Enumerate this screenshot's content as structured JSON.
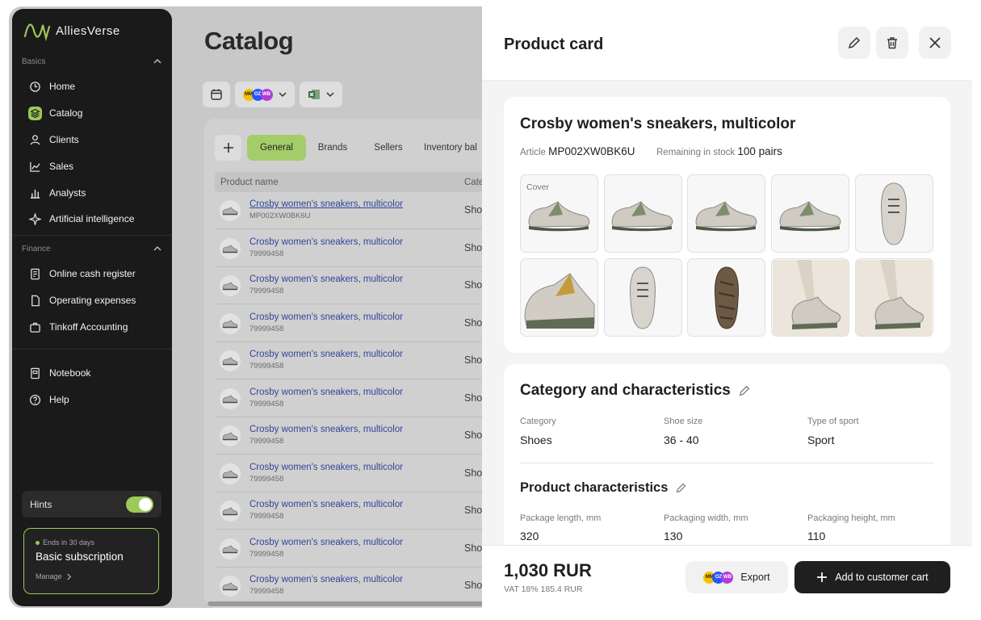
{
  "sidebar": {
    "logo_text": "AlliesVerse",
    "sections": [
      {
        "title": "Basics",
        "items": [
          "Home",
          "Catalog",
          "Clients",
          "Sales",
          "Analysts",
          "Artificial intelligence"
        ]
      },
      {
        "title": "Finance",
        "items": [
          "Online cash register",
          "Operating expenses",
          "Tinkoff Accounting"
        ]
      }
    ],
    "extra_items": [
      "Notebook",
      "Help"
    ],
    "hints_label": "Hints",
    "hints_on": true,
    "subscription": {
      "ends": "Ends in 30 days",
      "title": "Basic subscription",
      "manage": "Manage"
    },
    "accent_color": "#9bc95a"
  },
  "catalog": {
    "title": "Catalog",
    "marketplaces": [
      "MM",
      "OZ",
      "WB"
    ],
    "tabs": [
      "General",
      "Brands",
      "Sellers",
      "Inventory bal"
    ],
    "active_tab": "General",
    "columns": [
      "Product name",
      "Cate"
    ],
    "rows": [
      {
        "name": "Crosby women's sneakers, multicolor",
        "code": "MP002XW0BK6U",
        "category": "Sho"
      },
      {
        "name": "Crosby women's sneakers, multicolor",
        "code": "79999458",
        "category": "Sho"
      },
      {
        "name": "Crosby women's sneakers, multicolor",
        "code": "79999458",
        "category": "Sho"
      },
      {
        "name": "Crosby women's sneakers, multicolor",
        "code": "79999458",
        "category": "Sho"
      },
      {
        "name": "Crosby women's sneakers, multicolor",
        "code": "79999458",
        "category": "Sho"
      },
      {
        "name": "Crosby women's sneakers, multicolor",
        "code": "79999458",
        "category": "Sho"
      },
      {
        "name": "Crosby women's sneakers, multicolor",
        "code": "79999458",
        "category": "Sho"
      },
      {
        "name": "Crosby women's sneakers, multicolor",
        "code": "79999458",
        "category": "Sho"
      },
      {
        "name": "Crosby women's sneakers, multicolor",
        "code": "79999458",
        "category": "Sho"
      },
      {
        "name": "Crosby women's sneakers, multicolor",
        "code": "79999458",
        "category": "Sho"
      },
      {
        "name": "Crosby women's sneakers, multicolor",
        "code": "79999458",
        "category": "Sho"
      }
    ]
  },
  "card": {
    "title": "Product card",
    "product_name": "Crosby women's sneakers, multicolor",
    "article_label": "Article",
    "article": "MP002XW0BK6U",
    "stock_label": "Remaining in stock",
    "stock": "100 pairs",
    "cover_label": "Cover",
    "images": [
      "side-view",
      "side-view",
      "side-view",
      "side-view",
      "top-view",
      "front-view",
      "top-view",
      "sole-view",
      "worn-view",
      "worn-view"
    ],
    "category_section": {
      "title": "Category and characteristics",
      "fields": [
        {
          "label": "Category",
          "value": "Shoes"
        },
        {
          "label": "Shoe size",
          "value": "36 - 40"
        },
        {
          "label": "Type of sport",
          "value": "Sport"
        }
      ]
    },
    "product_section": {
      "title": "Product characteristics",
      "fields": [
        {
          "label": "Package length, mm",
          "value": "320"
        },
        {
          "label": "Packaging width, mm",
          "value": "130"
        },
        {
          "label": "Packaging height, mm",
          "value": "110"
        }
      ]
    },
    "price": "1,030 RUR",
    "vat": "VAT 18% 185.4 RUR",
    "export_label": "Export",
    "add_cart_label": "Add to customer cart"
  }
}
